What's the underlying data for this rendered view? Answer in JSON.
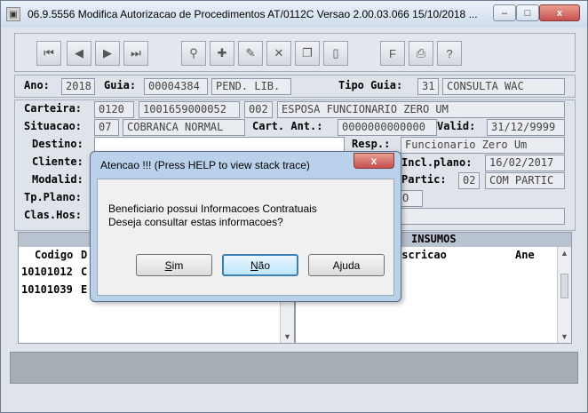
{
  "window": {
    "title": "06.9.5556  Modifica  Autorizacao de Procedimentos AT/0112C Versao 2.00.03.066 15/10/2018 ...",
    "minimize": "–",
    "maximize": "□",
    "close": "x"
  },
  "toolbar": {
    "buttons": [
      "first-record",
      "previous-record",
      "next-record",
      "last-record",
      "search",
      "add",
      "edit",
      "delete",
      "copy",
      "exit",
      "filter",
      "print",
      "help"
    ]
  },
  "header": {
    "ano_label": "Ano:",
    "ano": "2018",
    "guia_label": "Guia:",
    "guia": "00004384",
    "status": "PEND. LIB.",
    "tipo_guia_label": "Tipo Guia:",
    "tipo_guia": "31",
    "tipo_guia_desc": "CONSULTA WAC"
  },
  "form": {
    "carteira_label": "Carteira:",
    "carteira_1": "0120",
    "carteira_2": "1001659000052",
    "carteira_3": "002",
    "beneficiario": "ESPOSA FUNCIONARIO ZERO UM",
    "situacao_label": "Situacao:",
    "situacao_code": "07",
    "situacao": "COBRANCA NORMAL",
    "cart_ant_label": "Cart. Ant.:",
    "cart_ant": "0000000000000",
    "valid_label": "Valid:",
    "valid": "31/12/9999",
    "destino_label": "Destino:",
    "resp_label": "Resp.:",
    "resp": "Funcionario Zero Um",
    "cliente_label": "Cliente:",
    "incl_plano_label": "Incl.plano:",
    "incl_plano": "16/02/2017",
    "modalid_label": "Modalid:",
    "partic_label": "Partic:",
    "partic_code": "02",
    "partic": "COM PARTIC",
    "tp_plano_label": "Tp.Plano:",
    "tp_plano_partial": "O",
    "clas_hos_label": "Clas.Hos:"
  },
  "procedures": {
    "header_code": "Codigo",
    "header_desc_partial": "D",
    "rows": [
      {
        "code": "10101012",
        "desc_partial": "C"
      },
      {
        "code": "10101039",
        "desc_partial": "E"
      }
    ]
  },
  "insumos": {
    "section_title": "INSUMOS",
    "header_desc_partial": "escricao",
    "header_ane": "Ane"
  },
  "dialog": {
    "title": "Atencao !!!  (Press HELP to view stack trace)",
    "close": "x",
    "line1": "Beneficiario possui Informacoes Contratuais",
    "line2": "Deseja consultar estas informacoes?",
    "btn_sim_accel": "S",
    "btn_sim_rest": "im",
    "btn_nao_accel": "N",
    "btn_nao_rest": "ão",
    "btn_ajuda": "Ajuda"
  }
}
